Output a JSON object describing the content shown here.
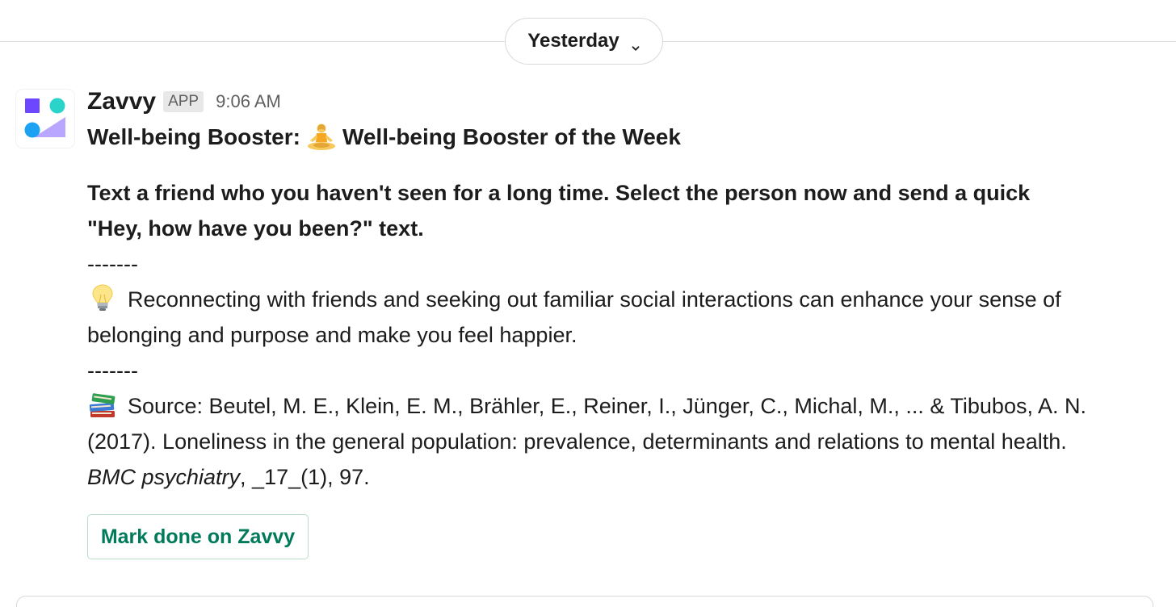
{
  "divider": {
    "date_label": "Yesterday",
    "chevron_icon": "chevron-down-icon"
  },
  "message": {
    "avatar_icon": "zavvy-logo",
    "sender": "Zavvy",
    "badge": "APP",
    "time": "9:06 AM",
    "title_prefix": "Well-being Booster:",
    "title_emoji": "person-in-lotus-position",
    "title_suffix": "Well-being Booster of the Week",
    "bold_paragraph": "Text a friend who you haven't seen for a long time. Select the person now and send a quick \"Hey, how have you been?\" text.",
    "separator_1": "-------",
    "tip_emoji": "light-bulb",
    "tip_text": "Reconnecting with friends and seeking out familiar social interactions can enhance your sense of belonging and purpose and make you feel happier.",
    "separator_2": "-------",
    "source_emoji": "books",
    "source_text_1": "Source: Beutel, M. E., Klein, E. M., Brähler, E., Reiner, I., Jünger, C., Michal, M., ... & Tibubos, A. N. (2017). Loneliness in the general population: prevalence, determinants and relations to mental health. ",
    "source_journal": "BMC psychiatry",
    "source_text_2": ", _17_(1), 97.",
    "button_label": "Mark done on Zavvy"
  },
  "colors": {
    "button_text": "#007a5a",
    "button_border": "#b9ddc9",
    "logo_purple": "#6c47ff",
    "logo_teal": "#2ad4c8",
    "logo_blue": "#1da1f2"
  }
}
